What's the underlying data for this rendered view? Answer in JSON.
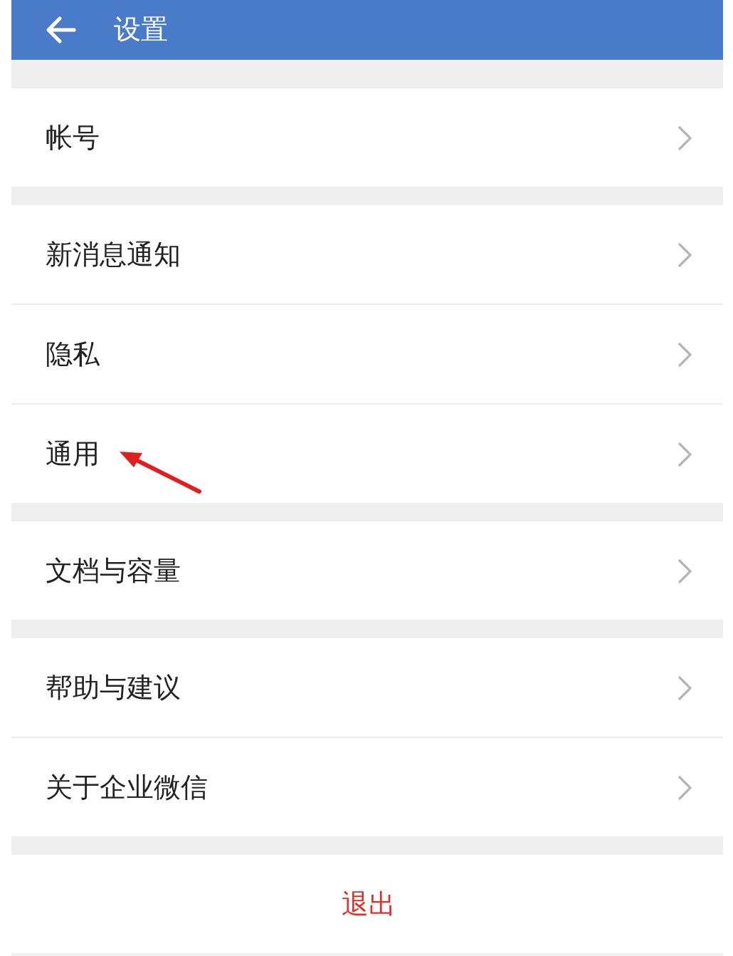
{
  "header": {
    "title": "设置"
  },
  "groups": [
    {
      "items": [
        {
          "label": "帐号"
        }
      ]
    },
    {
      "items": [
        {
          "label": "新消息通知"
        },
        {
          "label": "隐私"
        },
        {
          "label": "通用",
          "annotated": true
        }
      ]
    },
    {
      "items": [
        {
          "label": "文档与容量"
        }
      ]
    },
    {
      "items": [
        {
          "label": "帮助与建议"
        },
        {
          "label": "关于企业微信"
        }
      ]
    }
  ],
  "logout": {
    "label": "退出"
  }
}
